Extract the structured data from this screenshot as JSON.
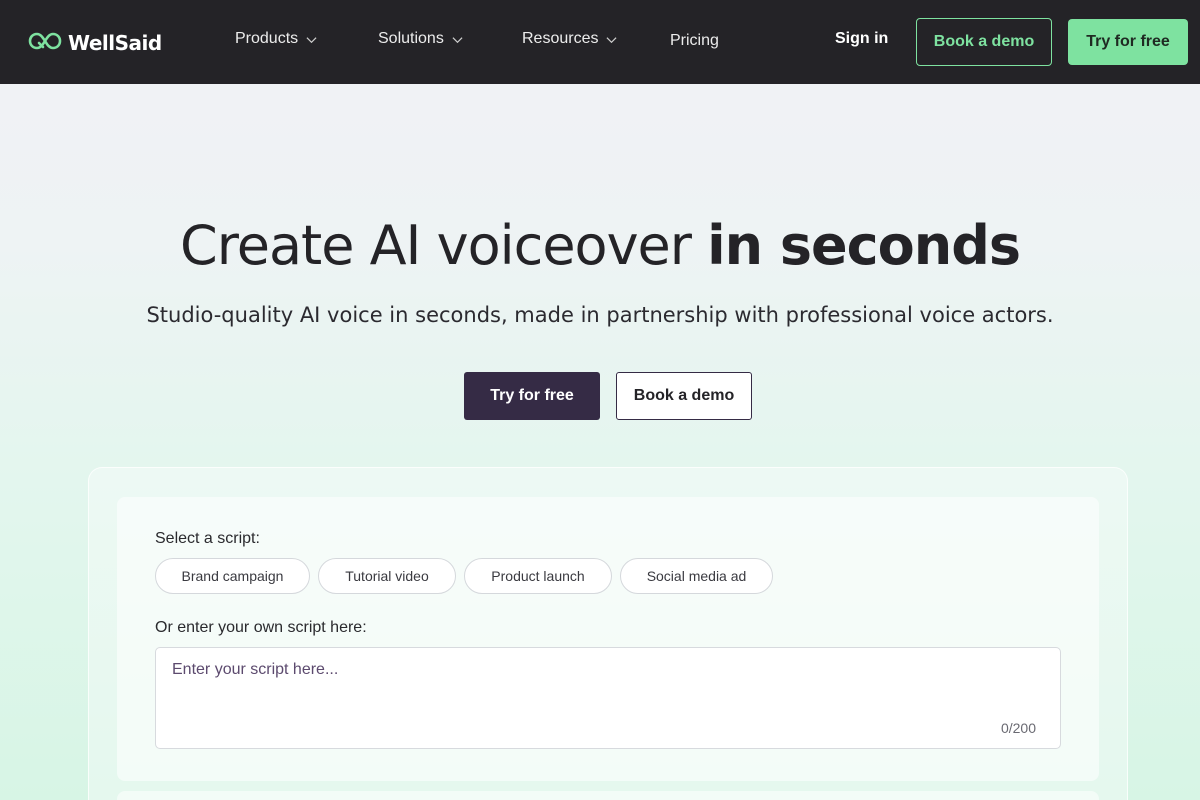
{
  "nav": {
    "logo_text": "WellSaid",
    "items": [
      {
        "label": "Products",
        "has_dropdown": true
      },
      {
        "label": "Solutions",
        "has_dropdown": true
      },
      {
        "label": "Resources",
        "has_dropdown": true
      },
      {
        "label": "Pricing",
        "has_dropdown": false
      }
    ],
    "sign_in": "Sign in",
    "book_demo": "Book a demo",
    "try_free": "Try for free"
  },
  "hero": {
    "title_regular": "Create AI voiceover ",
    "title_bold": "in seconds",
    "subtitle": "Studio-quality AI voice in seconds, made in partnership with professional voice actors.",
    "try_free": "Try for free",
    "book_demo": "Book a demo"
  },
  "demo": {
    "select_label": "Select a script:",
    "scripts": [
      "Brand campaign",
      "Tutorial video",
      "Product launch",
      "Social media ad"
    ],
    "own_label": "Or enter your own script here:",
    "placeholder": "Enter your script here...",
    "value": "",
    "counter": "0/200"
  },
  "colors": {
    "nav_bg": "#242327",
    "accent_green": "#7ee2a0",
    "primary_dark": "#352b45"
  }
}
